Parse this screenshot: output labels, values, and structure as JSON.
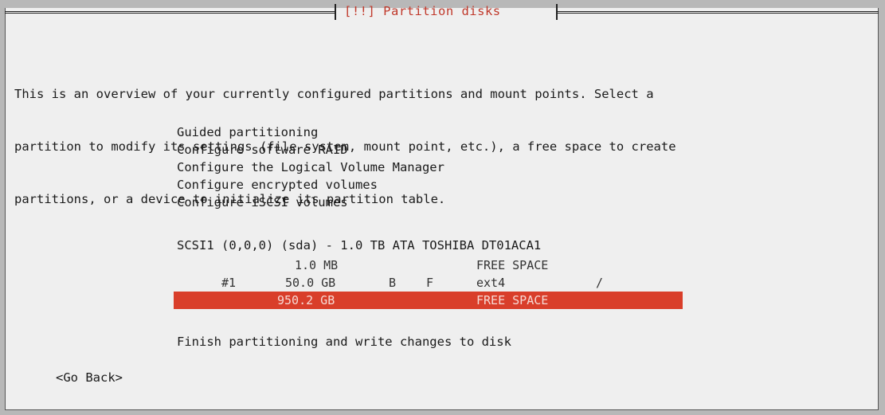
{
  "dialog": {
    "title": "[!!] Partition disks",
    "intro_lines": [
      "This is an overview of your currently configured partitions and mount points. Select a",
      "partition to modify its settings (file system, mount point, etc.), a free space to create",
      "partitions, or a device to initialize its partition table."
    ]
  },
  "menu": {
    "items": [
      "Guided partitioning",
      "Configure software RAID",
      "Configure the Logical Volume Manager",
      "Configure encrypted volumes",
      "Configure iSCSI volumes"
    ]
  },
  "disk": {
    "header": "SCSI1 (0,0,0) (sda) - 1.0 TB ATA TOSHIBA DT01ACA1",
    "partitions": [
      {
        "number": "",
        "size": "1.0 MB",
        "boot": "",
        "format": "",
        "type": "FREE SPACE",
        "mount": "",
        "selected": false
      },
      {
        "number": "#1",
        "size": "50.0 GB",
        "boot": "B",
        "format": "F",
        "type": "ext4",
        "mount": "/",
        "selected": false
      },
      {
        "number": "",
        "size": "950.2 GB",
        "boot": "",
        "format": "",
        "type": "FREE SPACE",
        "mount": "",
        "selected": true
      }
    ]
  },
  "actions": {
    "finish": "Finish partitioning and write changes to disk",
    "go_back": "<Go Back>"
  },
  "colors": {
    "selection": "#d93e2a",
    "title": "#c0392b",
    "background": "#efefef"
  }
}
